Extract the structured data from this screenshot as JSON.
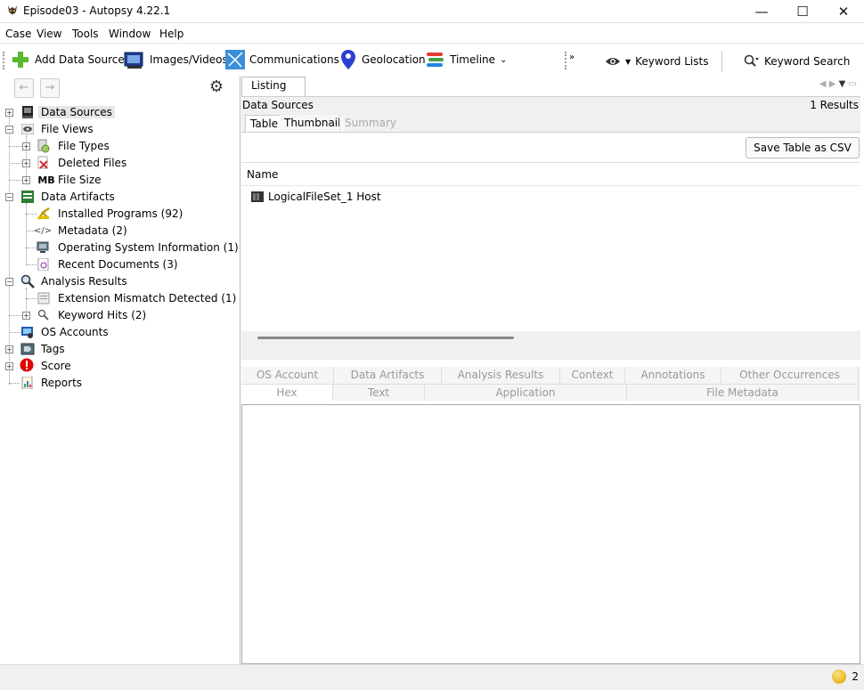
{
  "window": {
    "title": "Episode03 - Autopsy 4.22.1",
    "controls": {
      "minimize": "—",
      "maximize": "☐",
      "close": "✕"
    }
  },
  "menu": [
    "Case",
    "View",
    "Tools",
    "Window",
    "Help"
  ],
  "toolbar": {
    "add_data_source": "Add Data Source",
    "images_videos": "Images/Videos",
    "communications": "Communications",
    "geolocation": "Geolocation",
    "timeline": "Timeline",
    "keyword_lists": "Keyword Lists",
    "keyword_search": "Keyword Search"
  },
  "tree": {
    "data_sources": "Data Sources",
    "file_views": "File Views",
    "file_types": "File Types",
    "deleted_files": "Deleted Files",
    "file_size": "File Size",
    "file_size_icon": "MB",
    "data_artifacts": "Data Artifacts",
    "installed_programs": "Installed Programs (92)",
    "metadata": "Metadata (2)",
    "os_information": "Operating System Information (1)",
    "recent_documents": "Recent Documents (3)",
    "analysis_results": "Analysis Results",
    "extension_mismatch": "Extension Mismatch Detected (1)",
    "keyword_hits": "Keyword Hits (2)",
    "os_accounts": "OS Accounts",
    "tags": "Tags",
    "score": "Score",
    "reports": "Reports"
  },
  "listing": {
    "tab": "Listing",
    "title": "Data Sources",
    "results": "1   Results",
    "subtabs": {
      "table": "Table",
      "thumbnail": "Thumbnail",
      "summary": "Summary"
    },
    "save_csv": "Save Table as CSV",
    "column_name": "Name",
    "rows": [
      "LogicalFileSet_1 Host"
    ]
  },
  "viewer_tabs": {
    "row1": [
      "OS Account",
      "Data Artifacts",
      "Analysis Results",
      "Context",
      "Annotations",
      "Other Occurrences"
    ],
    "row2": [
      "Hex",
      "Text",
      "Application",
      "File Metadata"
    ]
  },
  "status": {
    "notifications": "2"
  }
}
